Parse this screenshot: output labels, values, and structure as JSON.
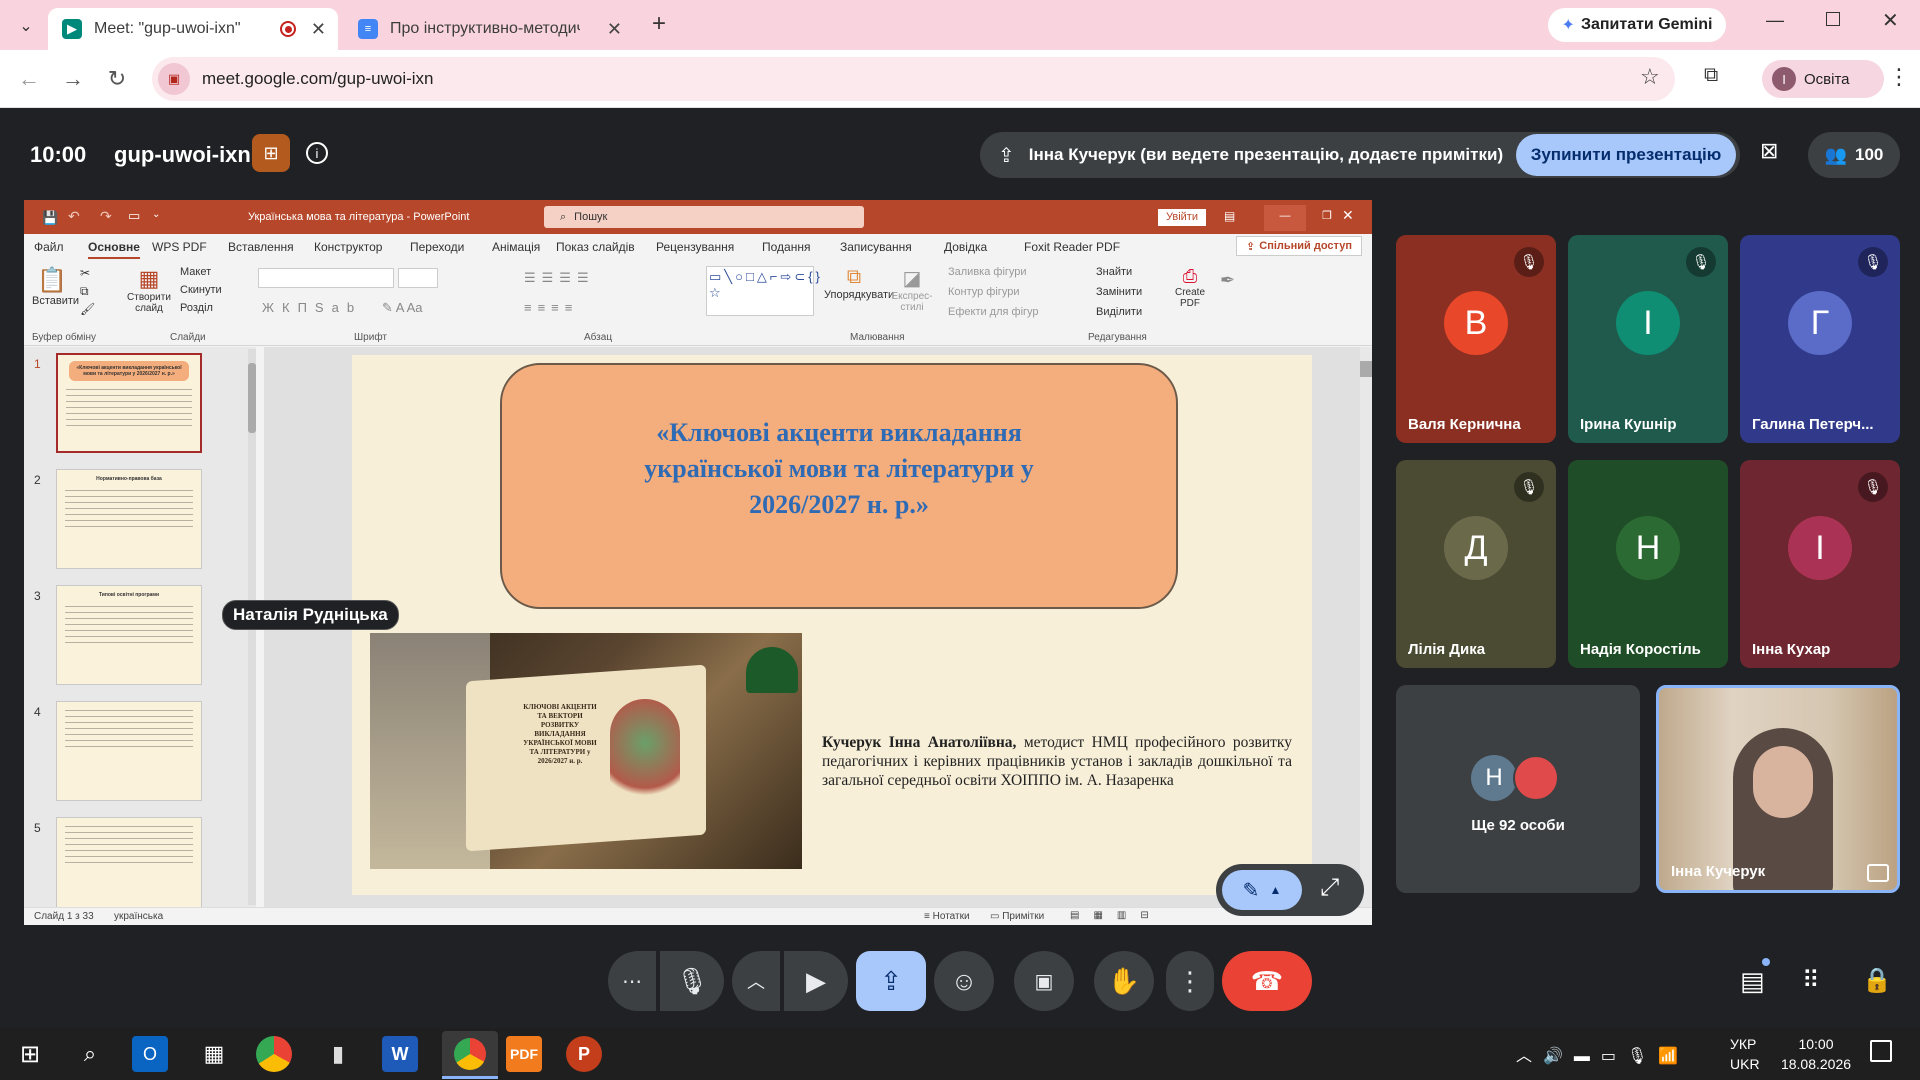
{
  "browser": {
    "tabs": [
      {
        "title": "Meet: \"gup-uwoi-ixn\""
      },
      {
        "title": "Про інструктивно-методичні р"
      }
    ],
    "gemini_label": "Запитати Gemini",
    "url": "meet.google.com/gup-uwoi-ixn",
    "profile_initial": "I",
    "profile_label": "Освіта"
  },
  "meet": {
    "time": "10:00",
    "meeting_code": "gup-uwoi-ixn",
    "presenting_text": "Інна Кучерук (ви ведете презентацію, додаєте примітки)",
    "stop_presenting": "Зупинити презентацію",
    "participant_count": "100",
    "pointer_name": "Наталія Рудніцька",
    "participants": [
      {
        "initial": "В",
        "name": "Валя Кернична",
        "color": "#e8472a",
        "bg": "#8b2f23",
        "muted": true
      },
      {
        "initial": "І",
        "name": "Ірина Кушнір",
        "color": "#0f8e73",
        "bg": "#1f5a4c",
        "muted": true
      },
      {
        "initial": "Г",
        "name": "Галина Петерч...",
        "color": "#5a6cc8",
        "bg": "#313a8a",
        "muted": true
      },
      {
        "initial": "Д",
        "name": "Лілія Дика",
        "color": "#6a6a4a",
        "bg": "#4b4b33",
        "muted": true
      },
      {
        "initial": "Н",
        "name": "Надія Коростіль",
        "color": "#2b6b33",
        "bg": "#1e4d27",
        "muted": false
      },
      {
        "initial": "І",
        "name": "Інна Кухар",
        "color": "#a35",
        "bg": "#6e2630",
        "muted": true
      }
    ],
    "more_people": "Ще 92 особи",
    "more_initial": "Н",
    "self_name": "Інна Кучерук"
  },
  "ppt": {
    "title": "Українська мова та література - PowerPoint",
    "search": "Пошук",
    "signin": "Увійти",
    "tabs": [
      "Файл",
      "Основне",
      "WPS PDF",
      "Вставлення",
      "Конструктор",
      "Переходи",
      "Анімація",
      "Показ слайдів",
      "Рецензування",
      "Подання",
      "Записування",
      "Довідка",
      "Foxit Reader PDF"
    ],
    "share": "Спільний доступ",
    "ribbon": {
      "paste": "Вставити",
      "new_slide": "Створити слайд",
      "layout": "Макет",
      "reset": "Скинути",
      "section": "Розділ",
      "arrange": "Упорядкувати",
      "quick_styles": "Експрес-стилі",
      "shape_fill": "Заливка фігури",
      "shape_outline": "Контур фігури",
      "shape_effects": "Ефекти для фігур",
      "find": "Знайти",
      "replace": "Замінити",
      "select": "Виділити",
      "create_pdf": "Create PDF",
      "groups": [
        "Буфер обміну",
        "Слайди",
        "Шрифт",
        "Абзац",
        "Малювання",
        "Редагування"
      ]
    },
    "thumbs": [
      "1",
      "2",
      "3",
      "4",
      "5"
    ],
    "thumb_titles": [
      "«Ключові акценти викладання української мови та літератури у 2026/2027 н. р.»",
      "Нормативно-правова база",
      "Типові освітні програми"
    ],
    "slide": {
      "title": "«Ключові акценти викладання української мови та літератури у 2026/2027 н. р.»",
      "author_bold": "Кучерук Інна Анатоліївна,",
      "author_rest": " методист НМЦ професійного розвитку педагогічних і керівних працівників установ і закладів дошкільної та загальної середньої освіти ХОІППО ім. А. Назаренка",
      "book_text": "КЛЮЧОВІ АКЦЕНТИ ТА ВЕКТОРИ РОЗВИТКУ ВИКЛАДАННЯ УКРАЇНСЬКОЇ МОВИ ТА ЛІТЕРАТУРИ у 2026/2027 н. р."
    },
    "status_slide": "Слайд 1 з 33",
    "status_lang": "українська",
    "notes": "Нотатки",
    "comments": "Примітки"
  },
  "taskbar": {
    "lang1": "УКР",
    "lang2": "UKR",
    "clock_time": "10:00",
    "clock_date": "18.08.2026"
  },
  "colors": {
    "chrome_tab_bg": "#f9d4df",
    "meet_bg": "#202124",
    "stop_btn": "#a8c7fa",
    "end_call": "#ea4335",
    "ppt_accent": "#b7472a",
    "slide_box": "#f4ad7c",
    "slide_title": "#2f6bb5"
  }
}
